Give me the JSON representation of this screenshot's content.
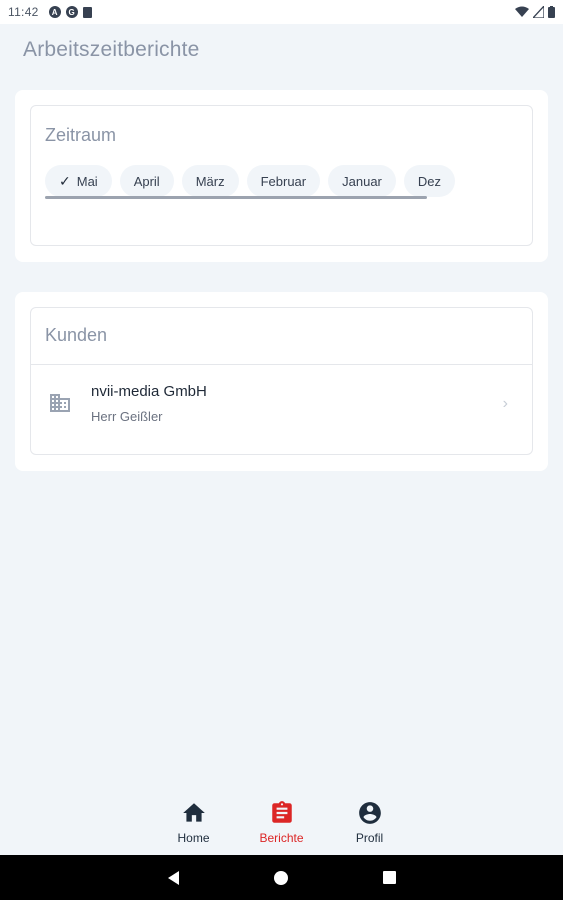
{
  "status_bar": {
    "time": "11:42",
    "left_icons": [
      "notification-a-icon",
      "notification-b-icon",
      "sd-card-icon"
    ],
    "right_icons": [
      "wifi-icon",
      "signal-icon",
      "battery-icon"
    ]
  },
  "page": {
    "title": "Arbeitszeitberichte"
  },
  "period": {
    "label": "Zeitraum",
    "selected": "Mai",
    "chips": [
      {
        "label": "Mai",
        "selected": true
      },
      {
        "label": "April",
        "selected": false
      },
      {
        "label": "März",
        "selected": false
      },
      {
        "label": "Februar",
        "selected": false
      },
      {
        "label": "Januar",
        "selected": false
      },
      {
        "label": "Dez",
        "selected": false
      }
    ]
  },
  "customers": {
    "label": "Kunden",
    "items": [
      {
        "name": "nvii-media GmbH",
        "contact": "Herr Geißler",
        "icon": "building-icon"
      }
    ]
  },
  "bottom_nav": {
    "active": "Berichte",
    "items": [
      {
        "label": "Home",
        "icon": "home-icon"
      },
      {
        "label": "Berichte",
        "icon": "clipboard-icon"
      },
      {
        "label": "Profil",
        "icon": "account-circle-icon"
      }
    ]
  },
  "colors": {
    "accent": "#dc2626",
    "nav_text": "#1f2d3d",
    "muted": "#8a94a6"
  }
}
